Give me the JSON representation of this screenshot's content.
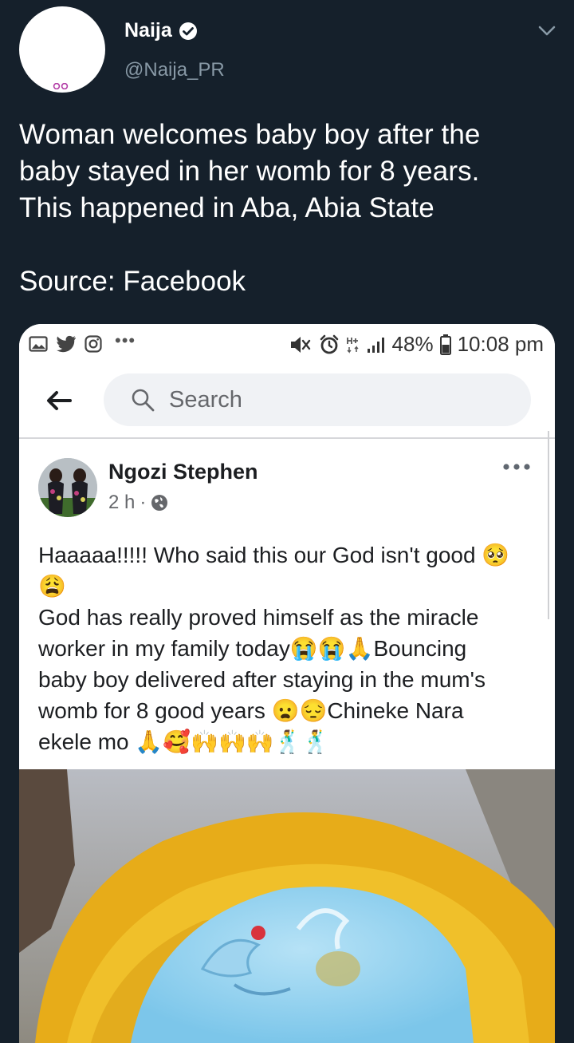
{
  "tweet": {
    "author_name": "Naija",
    "author_handle": "@Naija_PR",
    "text": "Woman welcomes baby boy after  the\nbaby stayed in her womb for 8 years.\nThis happened in Aba, Abia State",
    "source": "Source: Facebook"
  },
  "phone": {
    "status": {
      "battery": "48%",
      "time": "10:08 pm",
      "more": "•••"
    },
    "search": {
      "placeholder": "Search"
    },
    "post": {
      "author": "Ngozi Stephen",
      "time": "2 h",
      "dot": "·",
      "text": "Haaaaa!!!!! Who said this our God isn't good 🥺\n😩\nGod has really proved himself as the miracle\nworker in my family today😭😭🙏Bouncing\nbaby boy delivered after staying in the mum's\nwomb for 8 good years 😦😔Chineke Nara\nekele mo 🙏🥰🙌🙌🙌🕺🕺"
    }
  },
  "colors": {
    "background": "#15202b",
    "secondary_text": "#8899a6",
    "facebook_search": "#f0f2f5"
  }
}
